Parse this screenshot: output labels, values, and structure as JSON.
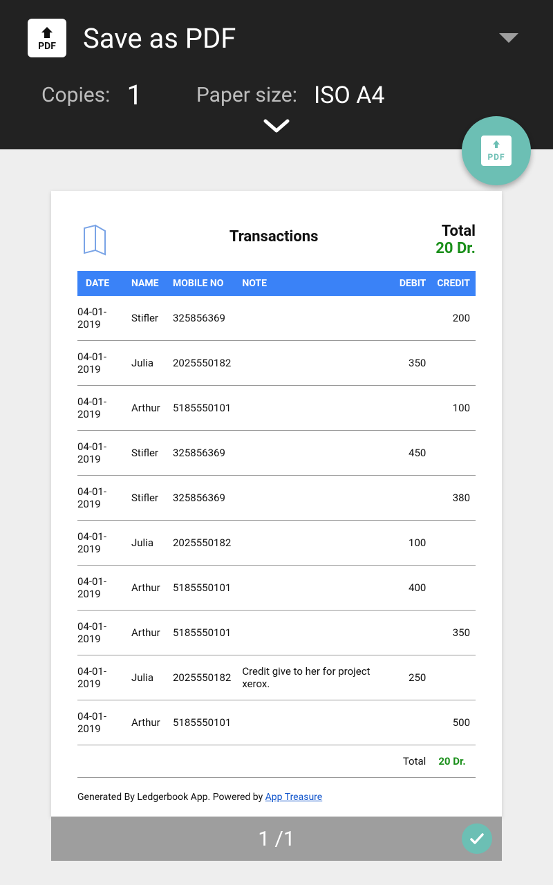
{
  "header": {
    "title": "Save as PDF",
    "copies_label": "Copies:",
    "copies_value": "1",
    "paper_label": "Paper size:",
    "paper_value": "ISO A4"
  },
  "doc": {
    "title": "Transactions",
    "total_label": "Total",
    "total_value": "20 Dr.",
    "columns": {
      "date": "DATE",
      "name": "NAME",
      "mobile": "MOBILE NO",
      "note": "NOTE",
      "debit": "DEBIT",
      "credit": "CREDIT"
    },
    "rows": [
      {
        "date": "04-01-2019",
        "name": "Stifler",
        "mobile": "325856369",
        "note": "",
        "debit": "",
        "credit": "200"
      },
      {
        "date": "04-01-2019",
        "name": "Julia",
        "mobile": "2025550182",
        "note": "",
        "debit": "350",
        "credit": ""
      },
      {
        "date": "04-01-2019",
        "name": "Arthur",
        "mobile": "5185550101",
        "note": "",
        "debit": "",
        "credit": "100"
      },
      {
        "date": "04-01-2019",
        "name": "Stifler",
        "mobile": "325856369",
        "note": "",
        "debit": "450",
        "credit": ""
      },
      {
        "date": "04-01-2019",
        "name": "Stifler",
        "mobile": "325856369",
        "note": "",
        "debit": "",
        "credit": "380"
      },
      {
        "date": "04-01-2019",
        "name": "Julia",
        "mobile": "2025550182",
        "note": "",
        "debit": "100",
        "credit": ""
      },
      {
        "date": "04-01-2019",
        "name": "Arthur",
        "mobile": "5185550101",
        "note": "",
        "debit": "400",
        "credit": ""
      },
      {
        "date": "04-01-2019",
        "name": "Arthur",
        "mobile": "5185550101",
        "note": "",
        "debit": "",
        "credit": "350"
      },
      {
        "date": "04-01-2019",
        "name": "Julia",
        "mobile": "2025550182",
        "note": "Credit give to her for project xerox.",
        "debit": "250",
        "credit": ""
      },
      {
        "date": "04-01-2019",
        "name": "Arthur",
        "mobile": "5185550101",
        "note": "",
        "debit": "",
        "credit": "500"
      }
    ],
    "footer_total_label": "Total",
    "footer_total_value": "20 Dr.",
    "generated_prefix": "Generated By Ledgerbook App. Powered by ",
    "generated_link": "App Treasure"
  },
  "pagebar": {
    "count": "1 /1"
  }
}
